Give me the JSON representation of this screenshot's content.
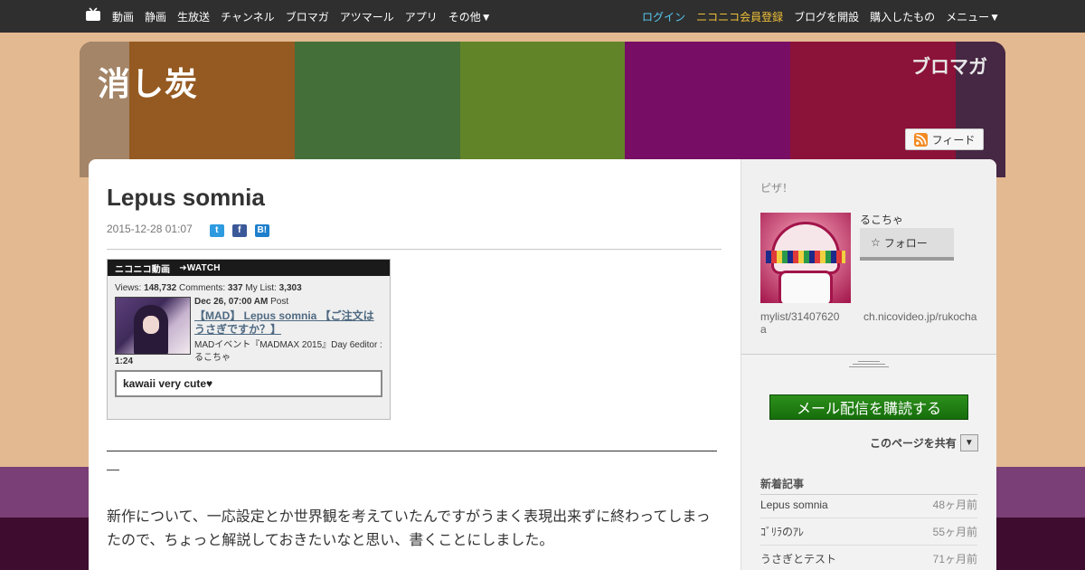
{
  "topnav": {
    "left_links": [
      "動画",
      "静画",
      "生放送",
      "チャンネル",
      "ブロマガ",
      "アツマール",
      "アプリ",
      "その他▼"
    ],
    "login": "ログイン",
    "register": "ニコニコ会員登録",
    "open_blog": "ブログを開設",
    "purchased": "購入したもの",
    "menu": "メニュー▼"
  },
  "header": {
    "blog_title": "消し炭",
    "logo_text": "ブロマガ",
    "feed_label": "フィード",
    "stripe_colors": [
      "#e3b991",
      "#cf7d2f",
      "#5f9a4e",
      "#88b838",
      "#a7128d",
      "#c11a4e",
      "#62375f"
    ]
  },
  "post": {
    "title": "Lepus somnia",
    "date": "2015-12-28 01:07",
    "embed": {
      "brand": "ニコニコ動画",
      "watch": "➜WATCH",
      "views_label": "Views:",
      "views": "148,732",
      "comments_label": "Comments:",
      "comments": "337",
      "mylist_label": "My List:",
      "mylist": "3,303",
      "posted_date": "Dec 26, 07:00 AM",
      "posted_suffix": "Post",
      "video_title": "【MAD】 Lepus somnia 【ご注文はうさぎですか？】",
      "description": "MADイベント『MADMAX 2015』Day 6editor : るこちゃ",
      "duration": "1:24",
      "top_comment": "kawaii very cute♥"
    },
    "dash": "—",
    "paragraph": "新作について、一応設定とか世界観を考えていたんですがうまく表現出来ずに終わってしまったので、ちょっと解説しておきたいなと思い、書くことにしました。"
  },
  "sidebar": {
    "label": "ピザ！",
    "profile_name": "るこちゃ",
    "follow_label": "フォロー",
    "mylist_link": "mylist/31407620",
    "mylist_link_tail": "a",
    "channel_link": "ch.nicovideo.jp/rukocha",
    "mail_button": "メール配信を購読する",
    "share_page": "このページを共有",
    "share_dropdown": "▼",
    "recent_heading": "新着記事",
    "recent": [
      {
        "title": "Lepus somnia",
        "age": "48ヶ月前"
      },
      {
        "title": "ｺﾞﾘﾗのｱﾚ",
        "age": "55ヶ月前"
      },
      {
        "title": "うさぎとテスト",
        "age": "71ヶ月前"
      }
    ]
  }
}
